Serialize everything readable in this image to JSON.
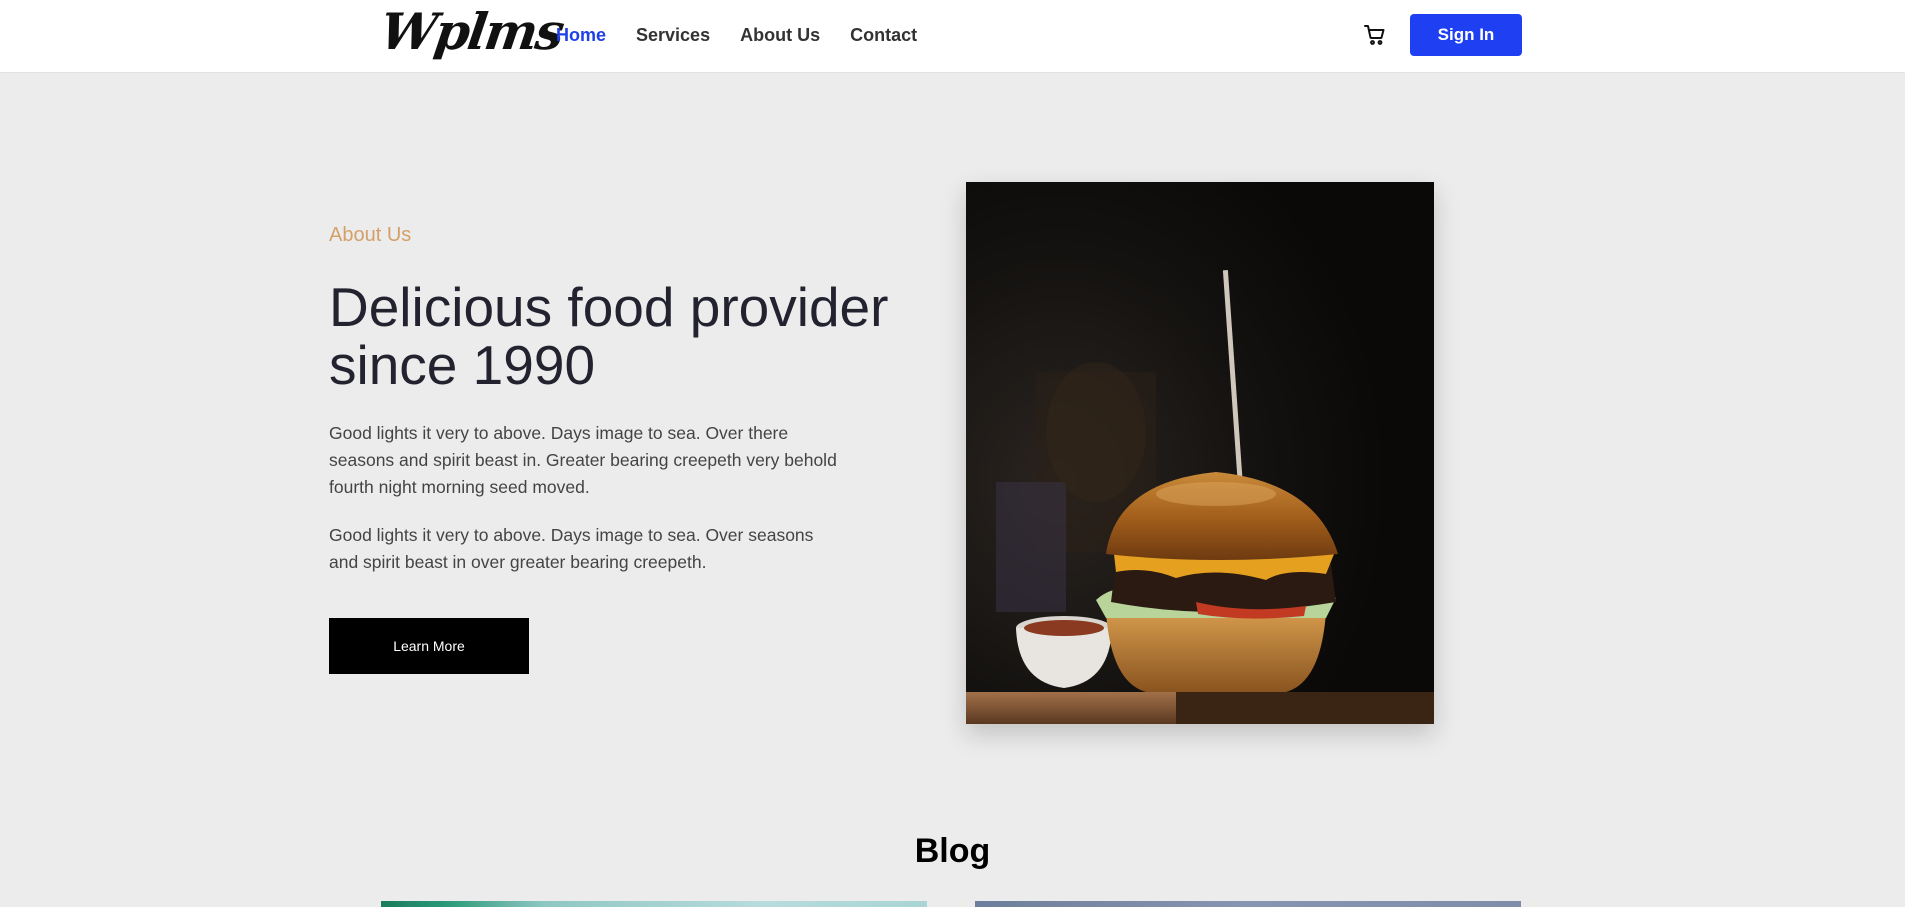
{
  "header": {
    "logo_text": "Wplms",
    "nav": [
      {
        "label": "Home",
        "active": true
      },
      {
        "label": "Services",
        "active": false
      },
      {
        "label": "About Us",
        "active": false
      },
      {
        "label": "Contact",
        "active": false
      }
    ],
    "cart_icon": "cart-icon",
    "signin_label": "Sign In"
  },
  "about": {
    "eyebrow": "About Us",
    "headline": "Delicious food provider since 1990",
    "paragraphs": [
      "Good lights it very to above. Days image to sea. Over there seasons and spirit beast in. Greater bearing creepeth very behold fourth night morning seed moved.",
      "Good lights it very to above. Days image to sea. Over seasons and spirit beast in over greater bearing creepeth."
    ],
    "cta_label": "Learn More",
    "image": "burger-photo"
  },
  "blog": {
    "title": "Blog",
    "cards": [
      {
        "image": "blog-card-image-1"
      },
      {
        "image": "blog-card-image-2"
      }
    ]
  },
  "colors": {
    "accent": "#1e40f2",
    "eyebrow": "#d4a06a",
    "page_bg": "#ececec",
    "header_bg": "#ffffff"
  }
}
